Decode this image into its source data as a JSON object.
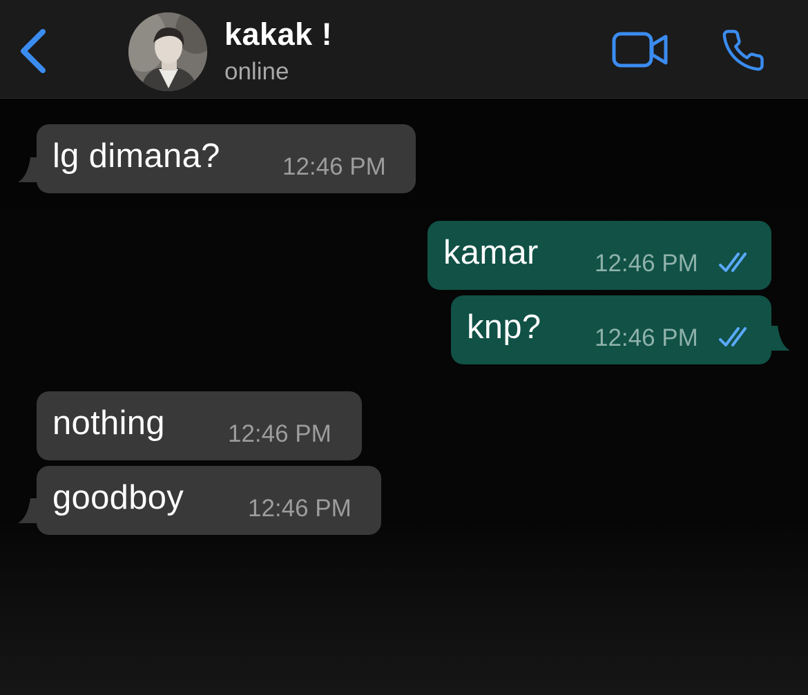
{
  "header": {
    "contact_name": "kakak !",
    "status": "online",
    "back_icon": "chevron-left-icon",
    "video_icon": "video-camera-icon",
    "call_icon": "phone-icon"
  },
  "messages": [
    {
      "direction": "incoming",
      "text": "lg dimana?",
      "time": "12:46 PM"
    },
    {
      "direction": "outgoing",
      "text": "kamar",
      "time": "12:46 PM",
      "status": "read"
    },
    {
      "direction": "outgoing",
      "text": "knp?",
      "time": "12:46 PM",
      "status": "read"
    },
    {
      "direction": "incoming",
      "text": "nothing",
      "time": "12:46 PM"
    },
    {
      "direction": "incoming",
      "text": "goodboy",
      "time": "12:46 PM"
    }
  ],
  "colors": {
    "accent": "#3b8cf0",
    "incoming_bubble": "#393939",
    "outgoing_bubble": "#115146",
    "read_ticks": "#5aa9ff",
    "header_bg": "#1b1b1b"
  }
}
